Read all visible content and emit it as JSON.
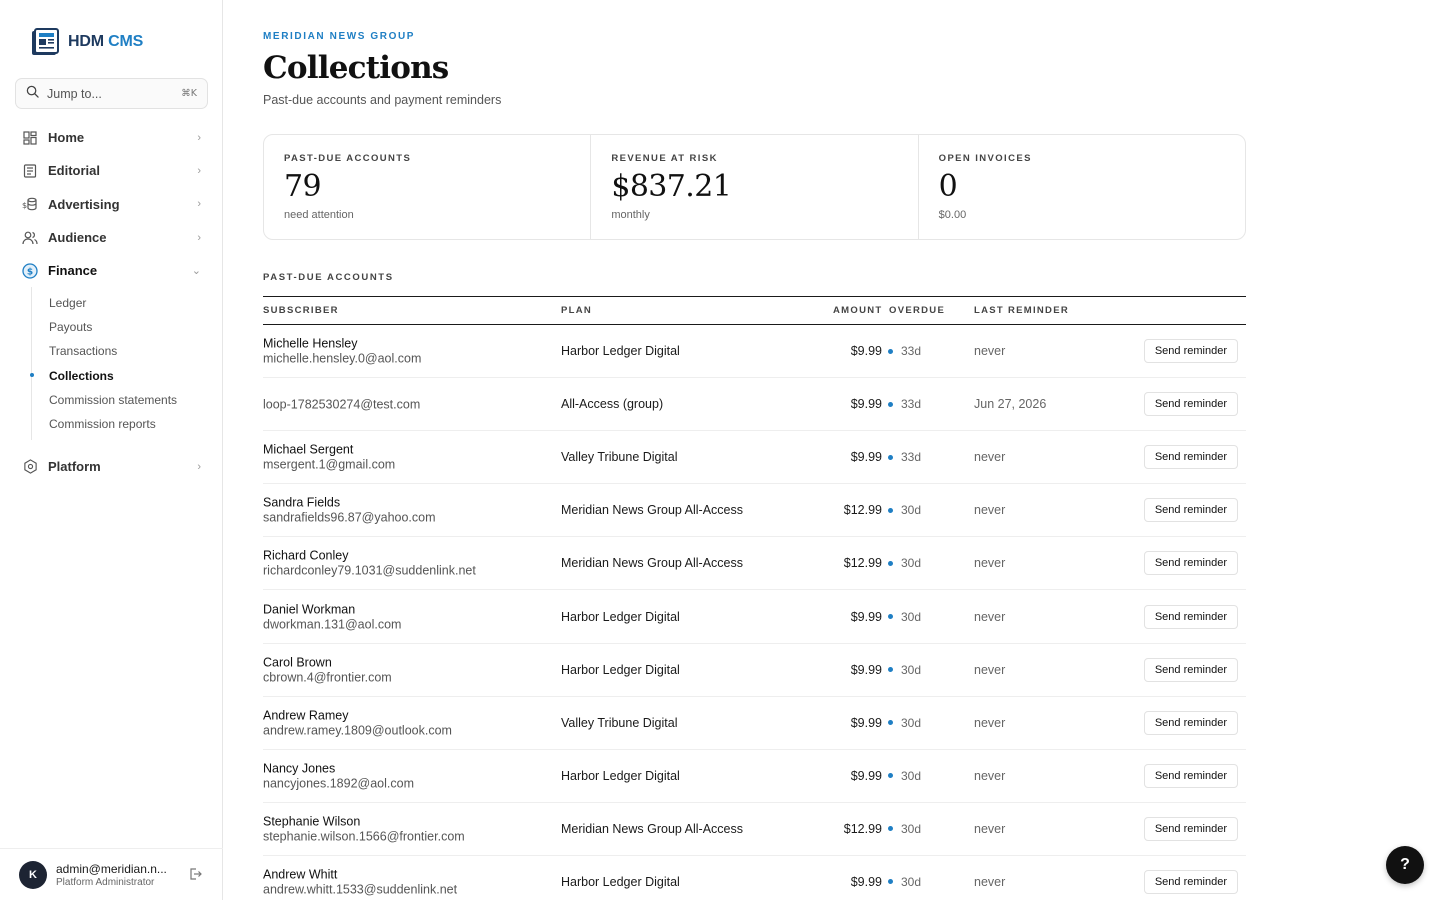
{
  "app": {
    "logo_main": "HDM",
    "logo_accent": "CMS"
  },
  "search": {
    "placeholder": "Jump to...",
    "shortcut": "⌘K"
  },
  "nav": {
    "home": "Home",
    "editorial": "Editorial",
    "advertising": "Advertising",
    "audience": "Audience",
    "finance": "Finance",
    "platform": "Platform",
    "finance_sub": {
      "ledger": "Ledger",
      "payouts": "Payouts",
      "transactions": "Transactions",
      "collections": "Collections",
      "commission_statements": "Commission statements",
      "commission_reports": "Commission reports"
    }
  },
  "user": {
    "avatar_initial": "K",
    "name": "admin@meridian.n...",
    "role": "Platform Administrator"
  },
  "page": {
    "org": "MERIDIAN NEWS GROUP",
    "title": "Collections",
    "subtitle": "Past-due accounts and payment reminders"
  },
  "stats": {
    "past_due": {
      "label": "PAST-DUE ACCOUNTS",
      "value": "79",
      "sub": "need attention"
    },
    "revenue": {
      "label": "REVENUE AT RISK",
      "value": "$837.21",
      "sub": "monthly"
    },
    "invoices": {
      "label": "OPEN INVOICES",
      "value": "0",
      "sub": "$0.00"
    }
  },
  "table": {
    "section_title": "PAST-DUE ACCOUNTS",
    "headers": {
      "subscriber": "SUBSCRIBER",
      "plan": "PLAN",
      "amount": "AMOUNT",
      "overdue": "OVERDUE",
      "last_reminder": "LAST REMINDER"
    },
    "action_label": "Send reminder",
    "rows": [
      {
        "name": "Michelle Hensley",
        "email": "michelle.hensley.0@aol.com",
        "plan": "Harbor Ledger Digital",
        "amount": "$9.99",
        "overdue": "33d",
        "last": "never"
      },
      {
        "name": "",
        "email": "loop-1782530274@test.com",
        "plan": "All-Access (group)",
        "amount": "$9.99",
        "overdue": "33d",
        "last": "Jun 27, 2026"
      },
      {
        "name": "Michael Sergent",
        "email": "msergent.1@gmail.com",
        "plan": "Valley Tribune Digital",
        "amount": "$9.99",
        "overdue": "33d",
        "last": "never"
      },
      {
        "name": "Sandra Fields",
        "email": "sandrafields96.87@yahoo.com",
        "plan": "Meridian News Group All-Access",
        "amount": "$12.99",
        "overdue": "30d",
        "last": "never"
      },
      {
        "name": "Richard Conley",
        "email": "richardconley79.1031@suddenlink.net",
        "plan": "Meridian News Group All-Access",
        "amount": "$12.99",
        "overdue": "30d",
        "last": "never"
      },
      {
        "name": "Daniel Workman",
        "email": "dworkman.131@aol.com",
        "plan": "Harbor Ledger Digital",
        "amount": "$9.99",
        "overdue": "30d",
        "last": "never"
      },
      {
        "name": "Carol Brown",
        "email": "cbrown.4@frontier.com",
        "plan": "Harbor Ledger Digital",
        "amount": "$9.99",
        "overdue": "30d",
        "last": "never"
      },
      {
        "name": "Andrew Ramey",
        "email": "andrew.ramey.1809@outlook.com",
        "plan": "Valley Tribune Digital",
        "amount": "$9.99",
        "overdue": "30d",
        "last": "never"
      },
      {
        "name": "Nancy Jones",
        "email": "nancyjones.1892@aol.com",
        "plan": "Harbor Ledger Digital",
        "amount": "$9.99",
        "overdue": "30d",
        "last": "never"
      },
      {
        "name": "Stephanie Wilson",
        "email": "stephanie.wilson.1566@frontier.com",
        "plan": "Meridian News Group All-Access",
        "amount": "$12.99",
        "overdue": "30d",
        "last": "never"
      },
      {
        "name": "Andrew Whitt",
        "email": "andrew.whitt.1533@suddenlink.net",
        "plan": "Harbor Ledger Digital",
        "amount": "$9.99",
        "overdue": "30d",
        "last": "never"
      }
    ]
  },
  "help_label": "?",
  "colors": {
    "accent": "#1f7fc4",
    "brand_dark": "#1e3a5f",
    "avatar_bg": "#1d2433"
  },
  "icons": {
    "logo": "newspaper-icon",
    "search": "search-icon",
    "home": "grid-icon",
    "editorial": "document-icon",
    "advertising": "coins-icon",
    "audience": "users-icon",
    "finance": "dollar-circle-icon",
    "platform": "hexagon-icon",
    "logout": "logout-icon"
  }
}
